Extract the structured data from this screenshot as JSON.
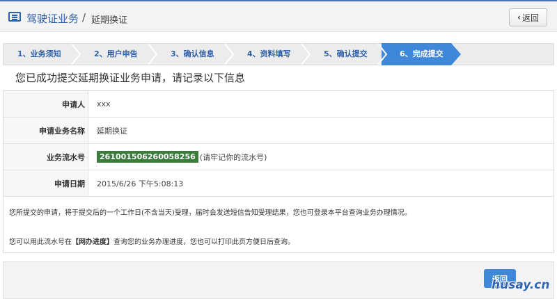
{
  "header": {
    "title": "驾驶证业务",
    "separator": "/",
    "subtitle": "延期换证",
    "back_label": "返回"
  },
  "steps": [
    {
      "label": "1、业务须知",
      "active": false
    },
    {
      "label": "2、用户申告",
      "active": false
    },
    {
      "label": "3、确认信息",
      "active": false
    },
    {
      "label": "4、资料填写",
      "active": false
    },
    {
      "label": "5、确认提交",
      "active": false
    },
    {
      "label": "6、完成提交",
      "active": true
    }
  ],
  "success_message": "您已成功提交延期换证业务申请，请记录以下信息",
  "info": {
    "applicant_label": "申请人",
    "applicant_value": "xxx",
    "business_label": "申请业务名称",
    "business_value": "延期换证",
    "serial_label": "业务流水号",
    "serial_value": "261001506260058256",
    "serial_hint": "(请牢记你的流水号)",
    "date_label": "申请日期",
    "date_value": "2015/6/26 下午5:08:13"
  },
  "notes": {
    "line1": "您所提交的申请，将于提交后的一个工作日(不含当天)受理，届时会发送短信告知受理结果，您也可登录本平台查询业务办理情况。",
    "line2_prefix": "您可以用此流水号在",
    "line2_link": "【网办进度】",
    "line2_suffix": "查询您的业务办理进度，您也可以打印此页方便日后查询。"
  },
  "footer": {
    "back_label": "返回"
  },
  "watermark": "husay.cn",
  "colors": {
    "brand_blue": "#2e5fa9",
    "active_step": "#3f87d9",
    "serial_bg": "#3a7d3a"
  }
}
